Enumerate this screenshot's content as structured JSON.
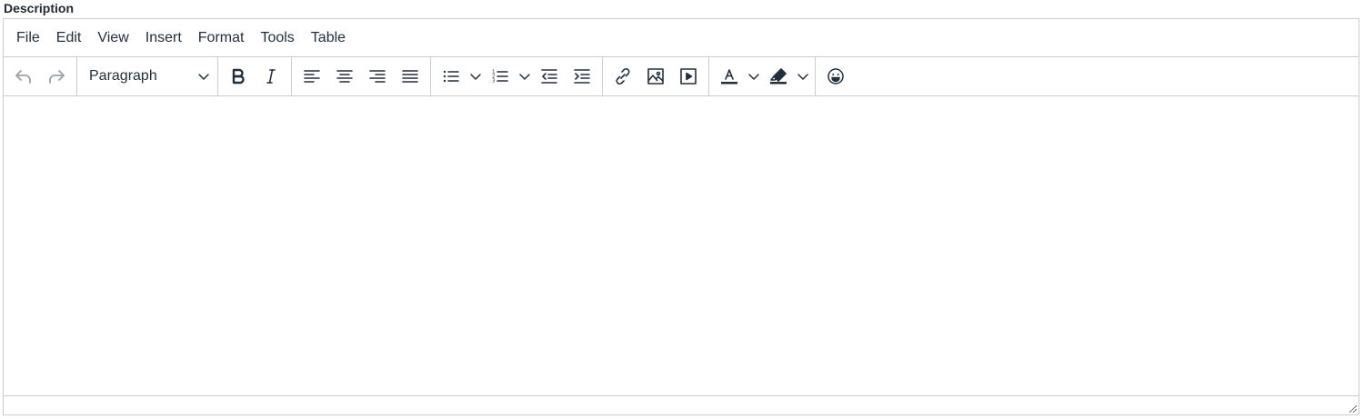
{
  "field": {
    "label": "Description"
  },
  "menubar": {
    "items": [
      "File",
      "Edit",
      "View",
      "Insert",
      "Format",
      "Tools",
      "Table"
    ]
  },
  "toolbar": {
    "block_format": {
      "selected": "Paragraph"
    },
    "icon_color": "#222f3e",
    "disabled_icons": [
      "undo-icon",
      "redo-icon"
    ]
  },
  "content": {
    "text": ""
  },
  "colors": {
    "border": "#cccccc",
    "text": "#222f3e"
  }
}
